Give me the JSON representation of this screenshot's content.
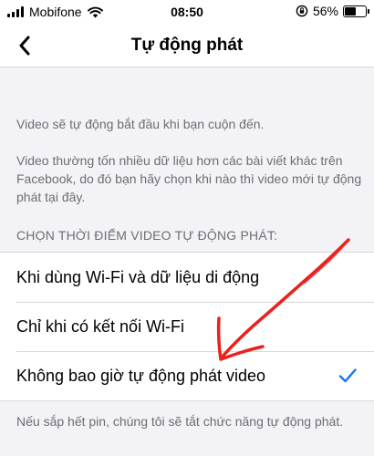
{
  "status_bar": {
    "carrier": "Mobifone",
    "time": "08:50",
    "battery_percent": "56%",
    "battery_level": 0.56,
    "icons": [
      "signal-icon",
      "wifi-icon",
      "rotation-lock-icon",
      "battery-icon"
    ]
  },
  "nav": {
    "title": "Tự động phát",
    "back_icon": "chevron-left-icon"
  },
  "description": {
    "line1": "Video sẽ tự động bắt đầu khi bạn cuộn đến.",
    "line2": "Video thường tốn nhiều dữ liệu hơn các bài viết khác trên Facebook, do đó bạn hãy chọn khi nào thì video mới tự động phát tại đây."
  },
  "section": {
    "header": "CHỌN THỜI ĐIỂM VIDEO TỰ ĐỘNG PHÁT:",
    "options": [
      {
        "label": "Khi dùng Wi-Fi và dữ liệu di động",
        "selected": false
      },
      {
        "label": "Chỉ khi có kết nối Wi-Fi",
        "selected": false
      },
      {
        "label": "Không bao giờ tự động phát video",
        "selected": true
      }
    ]
  },
  "footer": {
    "note": "Nếu sắp hết pin, chúng tôi sẽ tắt chức năng tự động phát."
  },
  "colors": {
    "accent": "#1877f2",
    "annotation": "#e8231f"
  }
}
